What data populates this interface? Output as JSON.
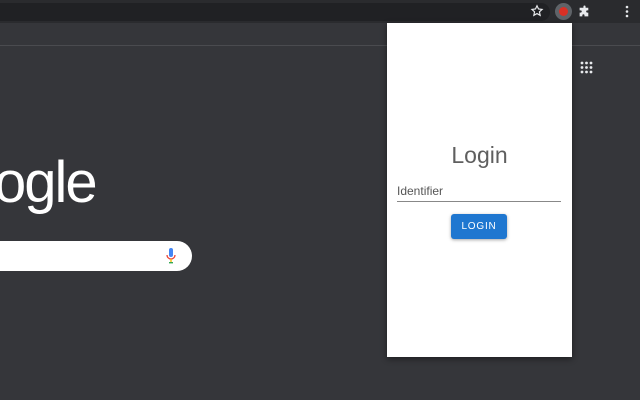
{
  "browser": {
    "icons": {
      "bookmark": "star-icon",
      "extension": "red-dot-extension-icon",
      "extensions_menu": "puzzle-icon",
      "menu": "three-dot-menu-icon",
      "apps": "apps-grid-icon"
    }
  },
  "newtab": {
    "logo_text": "ogle",
    "mic_icon": "microphone-icon"
  },
  "popup": {
    "title": "Login",
    "identifier_placeholder": "Identifier",
    "identifier_value": "",
    "login_label": "LOGIN",
    "accent_color": "#1f77d0"
  }
}
